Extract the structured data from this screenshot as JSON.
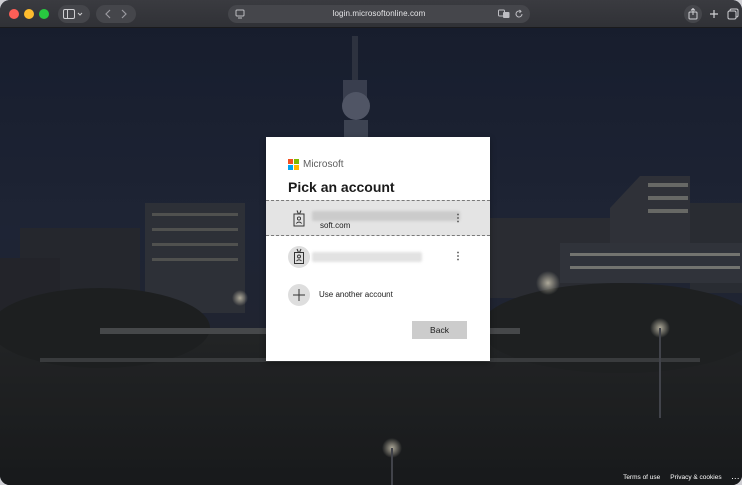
{
  "browser": {
    "url": "login.microsoftonline.com"
  },
  "dialog": {
    "brand": "Microsoft",
    "title": "Pick an account",
    "accounts": [
      {
        "email_suffix": "soft.com",
        "selected": true
      },
      {
        "email_suffix": "",
        "selected": false
      }
    ],
    "use_another": "Use another account",
    "more_symbol": "⋮",
    "back_label": "Back"
  },
  "footer": {
    "terms": "Terms of use",
    "privacy": "Privacy & cookies",
    "more": "..."
  },
  "colors": {
    "ms_red": "#f25022",
    "ms_green": "#7fba00",
    "ms_blue": "#00a4ef",
    "ms_yellow": "#ffb900",
    "back_button": "#cccccc"
  }
}
